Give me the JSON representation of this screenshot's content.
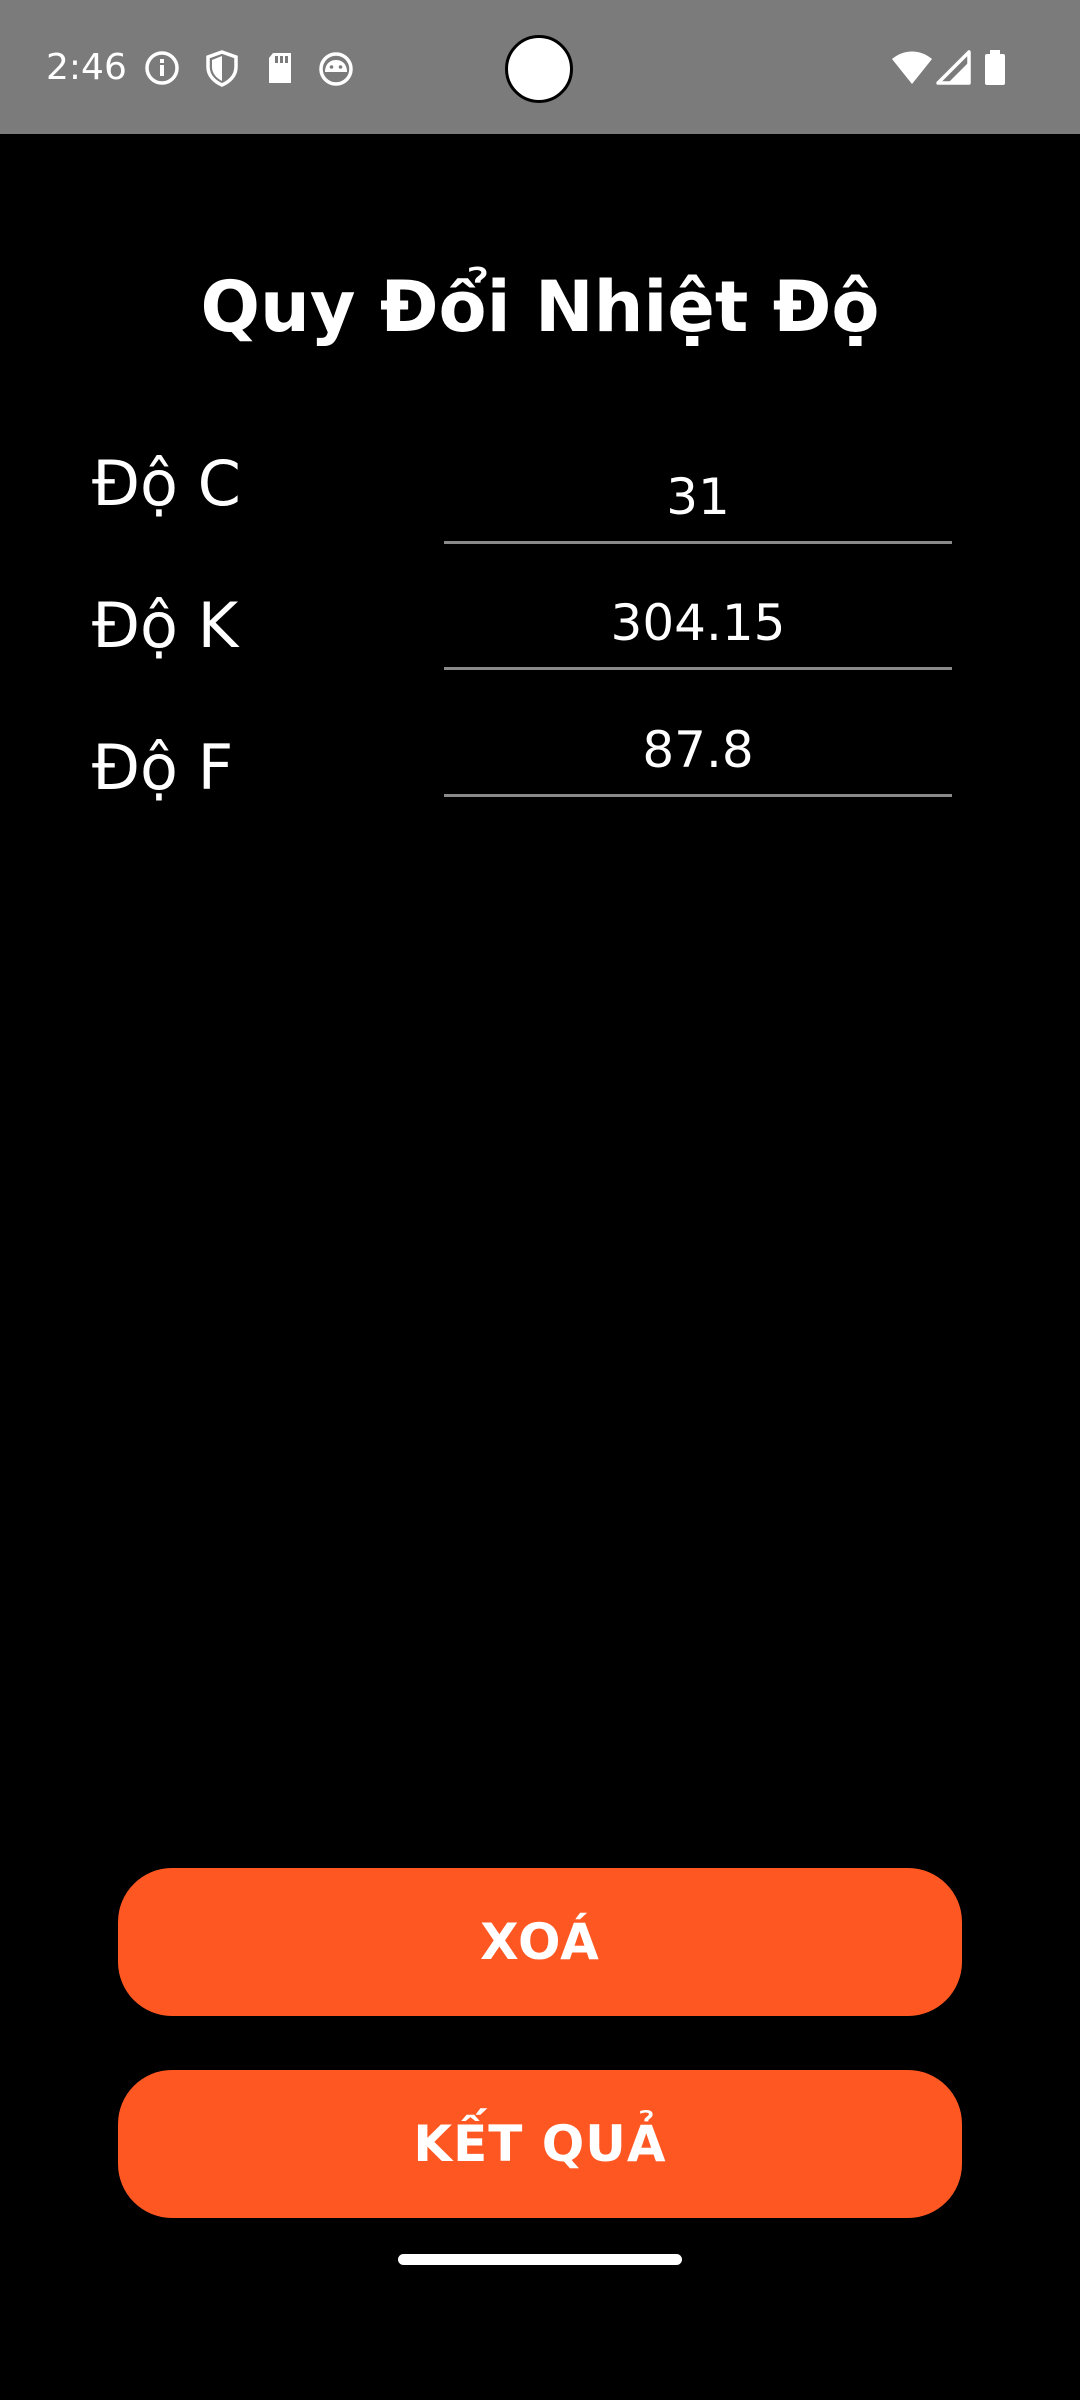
{
  "status_bar": {
    "time": "2:46",
    "left_icons": [
      "info-icon",
      "shield-icon",
      "sd-card-icon",
      "android-icon"
    ],
    "right_icons": [
      "wifi-icon",
      "signal-icon",
      "battery-icon"
    ]
  },
  "title": "Quy Đổi Nhiệt Độ",
  "fields": [
    {
      "label": "Độ C",
      "value": "31"
    },
    {
      "label": "Độ K",
      "value": "304.15"
    },
    {
      "label": "Độ F",
      "value": "87.8"
    }
  ],
  "buttons": {
    "clear_label": "XOÁ",
    "result_label": "KẾT QUẢ"
  },
  "colors": {
    "accent": "#ff5722",
    "background": "#000000",
    "status_bar": "#7b7b7b"
  }
}
